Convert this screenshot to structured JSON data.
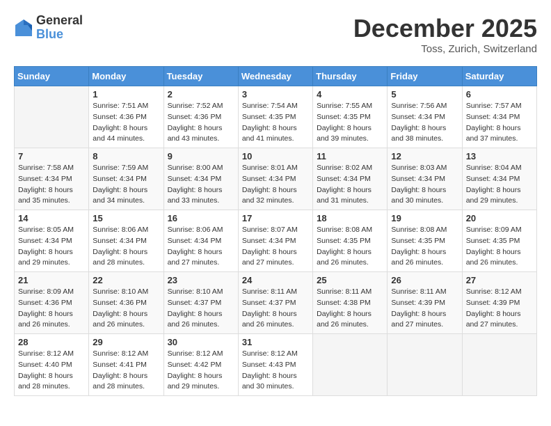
{
  "header": {
    "logo_general": "General",
    "logo_blue": "Blue",
    "month_title": "December 2025",
    "location": "Toss, Zurich, Switzerland"
  },
  "weekdays": [
    "Sunday",
    "Monday",
    "Tuesday",
    "Wednesday",
    "Thursday",
    "Friday",
    "Saturday"
  ],
  "weeks": [
    [
      {
        "day": "",
        "info": ""
      },
      {
        "day": "1",
        "info": "Sunrise: 7:51 AM\nSunset: 4:36 PM\nDaylight: 8 hours\nand 44 minutes."
      },
      {
        "day": "2",
        "info": "Sunrise: 7:52 AM\nSunset: 4:36 PM\nDaylight: 8 hours\nand 43 minutes."
      },
      {
        "day": "3",
        "info": "Sunrise: 7:54 AM\nSunset: 4:35 PM\nDaylight: 8 hours\nand 41 minutes."
      },
      {
        "day": "4",
        "info": "Sunrise: 7:55 AM\nSunset: 4:35 PM\nDaylight: 8 hours\nand 39 minutes."
      },
      {
        "day": "5",
        "info": "Sunrise: 7:56 AM\nSunset: 4:34 PM\nDaylight: 8 hours\nand 38 minutes."
      },
      {
        "day": "6",
        "info": "Sunrise: 7:57 AM\nSunset: 4:34 PM\nDaylight: 8 hours\nand 37 minutes."
      }
    ],
    [
      {
        "day": "7",
        "info": "Sunrise: 7:58 AM\nSunset: 4:34 PM\nDaylight: 8 hours\nand 35 minutes."
      },
      {
        "day": "8",
        "info": "Sunrise: 7:59 AM\nSunset: 4:34 PM\nDaylight: 8 hours\nand 34 minutes."
      },
      {
        "day": "9",
        "info": "Sunrise: 8:00 AM\nSunset: 4:34 PM\nDaylight: 8 hours\nand 33 minutes."
      },
      {
        "day": "10",
        "info": "Sunrise: 8:01 AM\nSunset: 4:34 PM\nDaylight: 8 hours\nand 32 minutes."
      },
      {
        "day": "11",
        "info": "Sunrise: 8:02 AM\nSunset: 4:34 PM\nDaylight: 8 hours\nand 31 minutes."
      },
      {
        "day": "12",
        "info": "Sunrise: 8:03 AM\nSunset: 4:34 PM\nDaylight: 8 hours\nand 30 minutes."
      },
      {
        "day": "13",
        "info": "Sunrise: 8:04 AM\nSunset: 4:34 PM\nDaylight: 8 hours\nand 29 minutes."
      }
    ],
    [
      {
        "day": "14",
        "info": "Sunrise: 8:05 AM\nSunset: 4:34 PM\nDaylight: 8 hours\nand 29 minutes."
      },
      {
        "day": "15",
        "info": "Sunrise: 8:06 AM\nSunset: 4:34 PM\nDaylight: 8 hours\nand 28 minutes."
      },
      {
        "day": "16",
        "info": "Sunrise: 8:06 AM\nSunset: 4:34 PM\nDaylight: 8 hours\nand 27 minutes."
      },
      {
        "day": "17",
        "info": "Sunrise: 8:07 AM\nSunset: 4:34 PM\nDaylight: 8 hours\nand 27 minutes."
      },
      {
        "day": "18",
        "info": "Sunrise: 8:08 AM\nSunset: 4:35 PM\nDaylight: 8 hours\nand 26 minutes."
      },
      {
        "day": "19",
        "info": "Sunrise: 8:08 AM\nSunset: 4:35 PM\nDaylight: 8 hours\nand 26 minutes."
      },
      {
        "day": "20",
        "info": "Sunrise: 8:09 AM\nSunset: 4:35 PM\nDaylight: 8 hours\nand 26 minutes."
      }
    ],
    [
      {
        "day": "21",
        "info": "Sunrise: 8:09 AM\nSunset: 4:36 PM\nDaylight: 8 hours\nand 26 minutes."
      },
      {
        "day": "22",
        "info": "Sunrise: 8:10 AM\nSunset: 4:36 PM\nDaylight: 8 hours\nand 26 minutes."
      },
      {
        "day": "23",
        "info": "Sunrise: 8:10 AM\nSunset: 4:37 PM\nDaylight: 8 hours\nand 26 minutes."
      },
      {
        "day": "24",
        "info": "Sunrise: 8:11 AM\nSunset: 4:37 PM\nDaylight: 8 hours\nand 26 minutes."
      },
      {
        "day": "25",
        "info": "Sunrise: 8:11 AM\nSunset: 4:38 PM\nDaylight: 8 hours\nand 26 minutes."
      },
      {
        "day": "26",
        "info": "Sunrise: 8:11 AM\nSunset: 4:39 PM\nDaylight: 8 hours\nand 27 minutes."
      },
      {
        "day": "27",
        "info": "Sunrise: 8:12 AM\nSunset: 4:39 PM\nDaylight: 8 hours\nand 27 minutes."
      }
    ],
    [
      {
        "day": "28",
        "info": "Sunrise: 8:12 AM\nSunset: 4:40 PM\nDaylight: 8 hours\nand 28 minutes."
      },
      {
        "day": "29",
        "info": "Sunrise: 8:12 AM\nSunset: 4:41 PM\nDaylight: 8 hours\nand 28 minutes."
      },
      {
        "day": "30",
        "info": "Sunrise: 8:12 AM\nSunset: 4:42 PM\nDaylight: 8 hours\nand 29 minutes."
      },
      {
        "day": "31",
        "info": "Sunrise: 8:12 AM\nSunset: 4:43 PM\nDaylight: 8 hours\nand 30 minutes."
      },
      {
        "day": "",
        "info": ""
      },
      {
        "day": "",
        "info": ""
      },
      {
        "day": "",
        "info": ""
      }
    ]
  ]
}
